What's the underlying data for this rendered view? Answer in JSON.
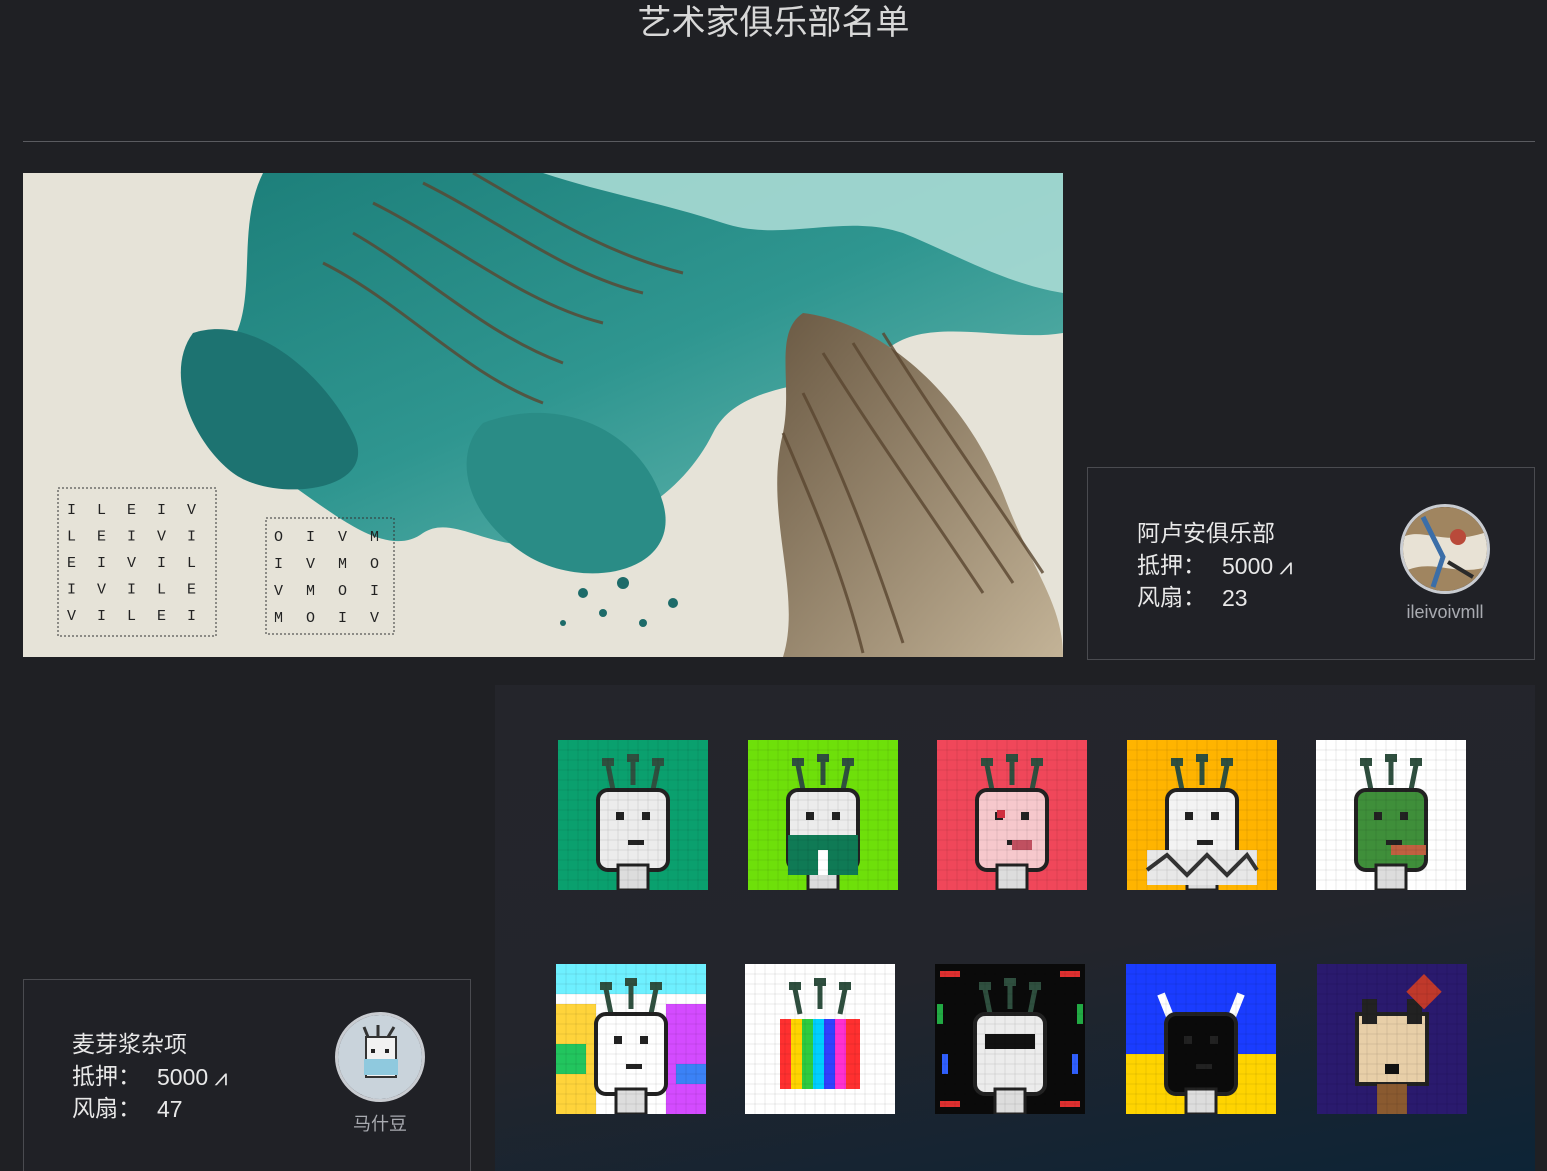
{
  "header": {
    "title": "艺术家俱乐部名单"
  },
  "banner": {
    "grid_left": [
      [
        "I",
        "L",
        "E",
        "I",
        "V"
      ],
      [
        "L",
        "E",
        "I",
        "V",
        "I"
      ],
      [
        "E",
        "I",
        "V",
        "I",
        "L"
      ],
      [
        "I",
        "V",
        "I",
        "L",
        "E"
      ],
      [
        "V",
        "I",
        "L",
        "E",
        "I"
      ]
    ],
    "grid_right": [
      [
        "O",
        "I",
        "V",
        "M"
      ],
      [
        "I",
        "V",
        "M",
        "O"
      ],
      [
        "V",
        "M",
        "O",
        "I"
      ],
      [
        "M",
        "O",
        "I",
        "V"
      ]
    ]
  },
  "clubs": [
    {
      "name": "阿卢安俱乐部",
      "stake_label": "抵押：",
      "stake_value": "5000 ⩘",
      "fans_label": "风扇：",
      "fans_value": "23",
      "owner": "ileivoivmll"
    },
    {
      "name": "麦芽浆杂项",
      "stake_label": "抵押：",
      "stake_value": "5000 ⩘",
      "fans_label": "风扇：",
      "fans_value": "47",
      "owner": "马什豆"
    }
  ],
  "gallery": {
    "tiles": [
      {
        "bg": "#0aa06e",
        "face": "#ececec",
        "variant": "plain"
      },
      {
        "bg": "#6ee00a",
        "face": "#ececec",
        "variant": "shirt"
      },
      {
        "bg": "#f0475a",
        "face": "#f6c8cc",
        "variant": "pig"
      },
      {
        "bg": "#ffb400",
        "face": "#f3f3f3",
        "variant": "ghost"
      },
      {
        "bg": "#ffffff",
        "face": "#3f8f3a",
        "variant": "frog"
      },
      {
        "bg": "#ffffff",
        "face": "#ffffff",
        "variant": "glitch"
      },
      {
        "bg": "#ffffff",
        "face": "#ececec",
        "variant": "tv"
      },
      {
        "bg": "#0a0a0a",
        "face": "#ececec",
        "variant": "shades"
      },
      {
        "bg": "#1a3cff",
        "face": "#0a0a0a",
        "variant": "horns"
      },
      {
        "bg": "#2a1a6e",
        "face": "#e8cfa8",
        "variant": "dog"
      }
    ]
  }
}
